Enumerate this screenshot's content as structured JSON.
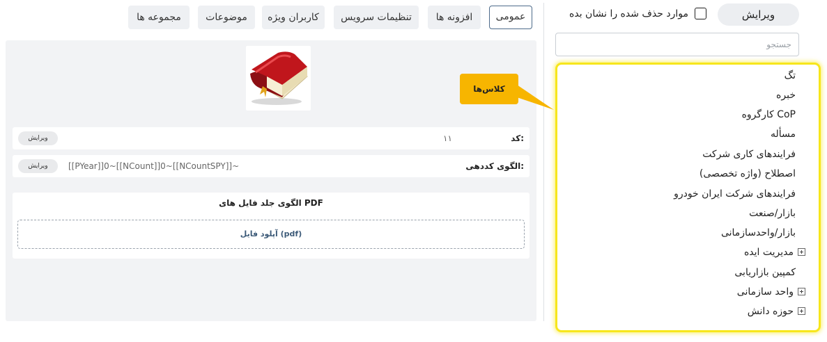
{
  "tabs": [
    "عمومی",
    "افزونه ها",
    "تنظیمات سرویس",
    "کاربران ویژه",
    "موضوعات",
    "مجموعه ها"
  ],
  "active_tab": "عمومی",
  "main": {
    "code": {
      "label": "کد:",
      "value": "۱۱",
      "edit_label": "ویرایش"
    },
    "code_pattern": {
      "label": "الگوی کددهی:",
      "value": "[[PYear]]0~[[NCount]]0~[[NCountSPY]]~",
      "edit_label": "ویرایش"
    },
    "pdf": {
      "title": "الگوی جلد فایل های PDF",
      "upload_label": "آپلود فایل (pdf)"
    }
  },
  "sidebar": {
    "edit_label": "ویرایش",
    "show_deleted_label": "موارد حذف شده را نشان بده",
    "show_deleted_checked": false,
    "search_placeholder": "جستجو",
    "tree": [
      {
        "label": "تگ",
        "expandable": false
      },
      {
        "label": "خبره",
        "expandable": false
      },
      {
        "label": "کارگروه CoP",
        "expandable": false
      },
      {
        "label": "مسأله",
        "expandable": false
      },
      {
        "label": "فرایندهای کاری شرکت",
        "expandable": false
      },
      {
        "label": "اصطلاح (واژه تخصصی)",
        "expandable": false
      },
      {
        "label": "فرایندهای شرکت ایران خودرو",
        "expandable": false
      },
      {
        "label": "بازار/صنعت",
        "expandable": false
      },
      {
        "label": "بازار/واحدسازمانی",
        "expandable": false
      },
      {
        "label": "مدیریت ایده",
        "expandable": true
      },
      {
        "label": "کمپین بازاریابی",
        "expandable": false
      },
      {
        "label": "واحد سازمانی",
        "expandable": true
      },
      {
        "label": "حوزه دانش",
        "expandable": true
      }
    ]
  },
  "callout": {
    "text": "کلاس‌ها"
  },
  "colors": {
    "highlight": "#f7e61c",
    "callout": "#f7b500",
    "active_tab_border": "#4d6b8a",
    "panel_bg": "#f2f3f5"
  },
  "icons": {
    "book": "red-book-icon",
    "expand": "plus-square-icon",
    "checkbox": "checkbox-icon"
  }
}
